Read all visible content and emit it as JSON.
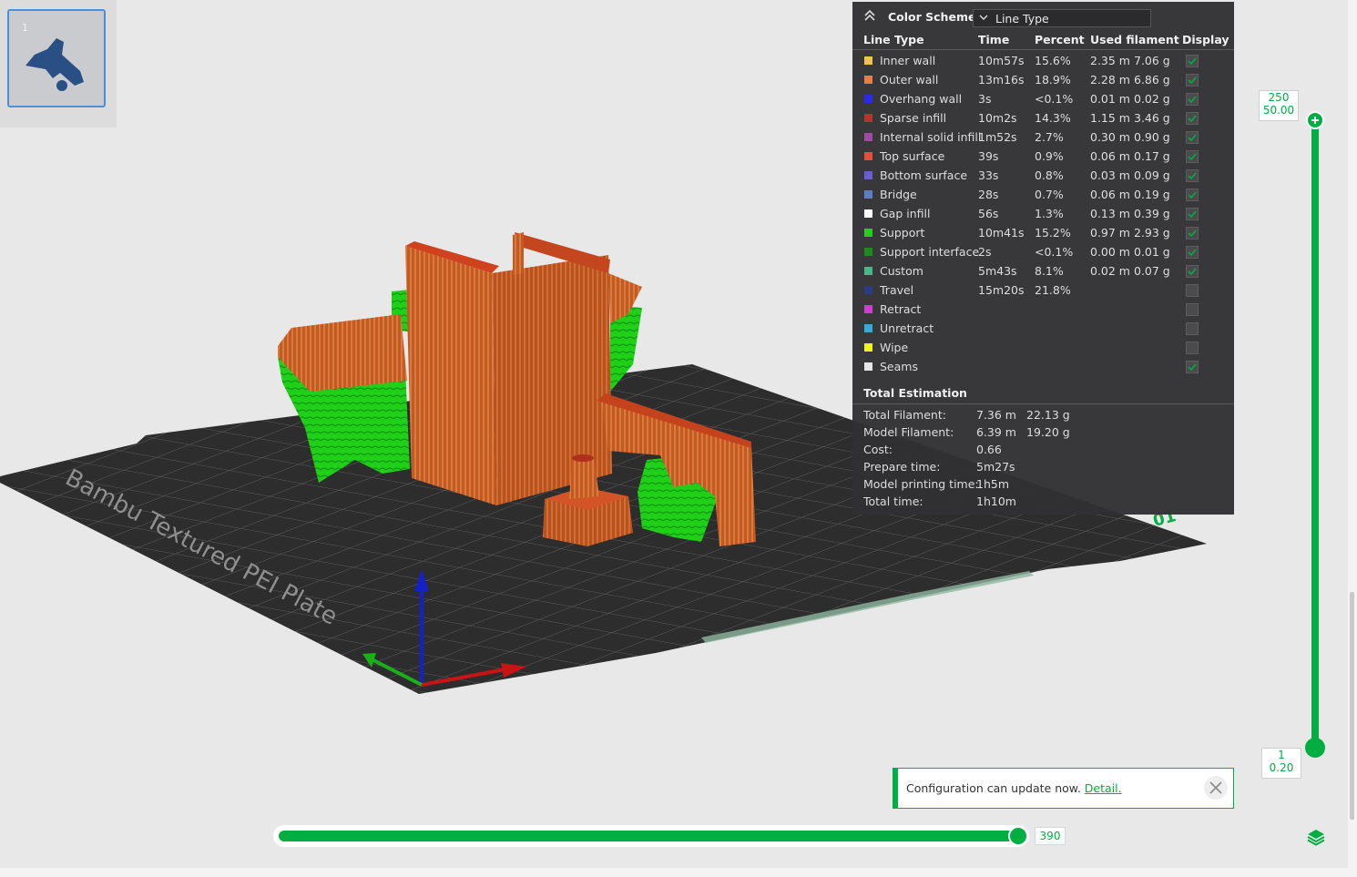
{
  "plate": {
    "thumbnail_number": "1",
    "bed_label": "Bambu Textured PEI Plate",
    "corner_label": "01"
  },
  "legend": {
    "scheme_label": "Color Scheme",
    "scheme_value": "Line Type",
    "columns": [
      "Line Type",
      "Time",
      "Percent",
      "Used filament",
      "Display"
    ],
    "rows": [
      {
        "name": "Inner wall",
        "time": "10m57s",
        "percent": "15.6%",
        "length": "2.35 m",
        "weight": "7.06 g",
        "color": "#f2c14e",
        "checked": true
      },
      {
        "name": "Outer wall",
        "time": "13m16s",
        "percent": "18.9%",
        "length": "2.28 m",
        "weight": "6.86 g",
        "color": "#ee7c3a",
        "checked": true
      },
      {
        "name": "Overhang wall",
        "time": "3s",
        "percent": "<0.1%",
        "length": "0.01 m",
        "weight": "0.02 g",
        "color": "#2a2ae8",
        "checked": true
      },
      {
        "name": "Sparse infill",
        "time": "10m2s",
        "percent": "14.3%",
        "length": "1.15 m",
        "weight": "3.46 g",
        "color": "#b8332c",
        "checked": true
      },
      {
        "name": "Internal solid infill",
        "time": "1m52s",
        "percent": "2.7%",
        "length": "0.30 m",
        "weight": "0.90 g",
        "color": "#a349a4",
        "checked": true
      },
      {
        "name": "Top surface",
        "time": "39s",
        "percent": "0.9%",
        "length": "0.06 m",
        "weight": "0.17 g",
        "color": "#e74c3c",
        "checked": true
      },
      {
        "name": "Bottom surface",
        "time": "33s",
        "percent": "0.8%",
        "length": "0.03 m",
        "weight": "0.09 g",
        "color": "#6b5fc7",
        "checked": true
      },
      {
        "name": "Bridge",
        "time": "28s",
        "percent": "0.7%",
        "length": "0.06 m",
        "weight": "0.19 g",
        "color": "#5d7fbf",
        "checked": true
      },
      {
        "name": "Gap infill",
        "time": "56s",
        "percent": "1.3%",
        "length": "0.13 m",
        "weight": "0.39 g",
        "color": "#ffffff",
        "checked": true
      },
      {
        "name": "Support",
        "time": "10m41s",
        "percent": "15.2%",
        "length": "0.97 m",
        "weight": "2.93 g",
        "color": "#22d11b",
        "checked": true
      },
      {
        "name": "Support interface",
        "time": "2s",
        "percent": "<0.1%",
        "length": "0.00 m",
        "weight": "0.01 g",
        "color": "#1f8a1f",
        "checked": true
      },
      {
        "name": "Custom",
        "time": "5m43s",
        "percent": "8.1%",
        "length": "0.02 m",
        "weight": "0.07 g",
        "color": "#4fb38a",
        "checked": true
      },
      {
        "name": "Travel",
        "time": "15m20s",
        "percent": "21.8%",
        "length": "",
        "weight": "",
        "color": "#2c3a8a",
        "checked": false
      },
      {
        "name": "Retract",
        "time": "",
        "percent": "",
        "length": "",
        "weight": "",
        "color": "#d33bd3",
        "checked": false
      },
      {
        "name": "Unretract",
        "time": "",
        "percent": "",
        "length": "",
        "weight": "",
        "color": "#3fa6d8",
        "checked": false
      },
      {
        "name": "Wipe",
        "time": "",
        "percent": "",
        "length": "",
        "weight": "",
        "color": "#f2f21f",
        "checked": false
      },
      {
        "name": "Seams",
        "time": "",
        "percent": "",
        "length": "",
        "weight": "",
        "color": "#e6e6e6",
        "checked": true
      }
    ],
    "total_title": "Total Estimation",
    "totals": [
      {
        "label": "Total Filament:",
        "v1": "7.36 m",
        "v2": "22.13 g"
      },
      {
        "label": "Model Filament:",
        "v1": "6.39 m",
        "v2": "19.20 g"
      },
      {
        "label": "Cost:",
        "v1": "0.66",
        "v2": ""
      },
      {
        "label": "Prepare time:",
        "v1": "5m27s",
        "v2": ""
      },
      {
        "label": "Model printing time:",
        "v1": "1h5m",
        "v2": ""
      },
      {
        "label": "Total time:",
        "v1": "1h10m",
        "v2": ""
      }
    ]
  },
  "layer_slider": {
    "top_layer": "250",
    "top_height": "50.00",
    "bottom_layer": "1",
    "bottom_height": "0.20"
  },
  "move_slider": {
    "value": "390"
  },
  "notification": {
    "message": "Configuration can update now.",
    "link": "Detail."
  },
  "colors": {
    "accent": "#00ae42",
    "panel": "#313133",
    "model": "#c8602a",
    "support": "#22c81b"
  }
}
